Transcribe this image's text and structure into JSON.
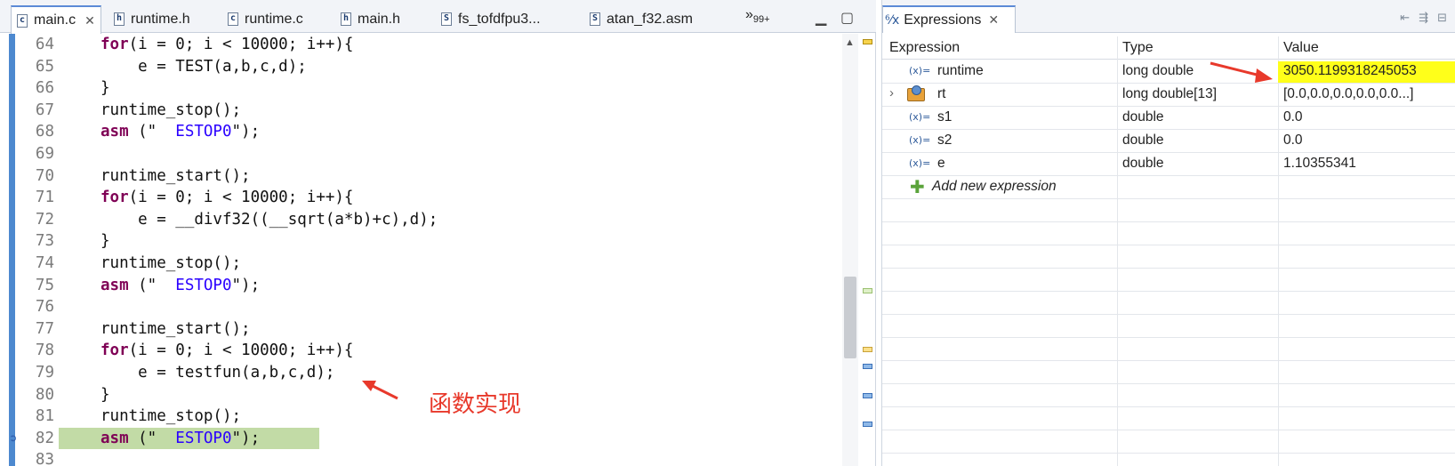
{
  "editor": {
    "tabs": [
      {
        "label": "main.c",
        "type_letter": "c",
        "active": true,
        "closable": true
      },
      {
        "label": "runtime.h",
        "type_letter": "h"
      },
      {
        "label": "runtime.c",
        "type_letter": "c"
      },
      {
        "label": "main.h",
        "type_letter": "h"
      },
      {
        "label": "fs_tofdfpu3...",
        "type_letter": "S"
      },
      {
        "label": "atan_f32.asm",
        "type_letter": "S"
      }
    ],
    "overflow_label": "»",
    "overflow_count": "99+",
    "minimize_icon": "minimize-icon",
    "maximize_icon": "maximize-icon",
    "current_line": 82,
    "lines": [
      {
        "num": "64",
        "text": "    for(i = 0; i < 10000; i++){"
      },
      {
        "num": "65",
        "text": "        e = TEST(a,b,c,d);"
      },
      {
        "num": "66",
        "text": "    }"
      },
      {
        "num": "67",
        "text": "    runtime_stop();"
      },
      {
        "num": "68",
        "text": "    asm (\"  ESTOP0\");"
      },
      {
        "num": "69",
        "text": ""
      },
      {
        "num": "70",
        "text": "    runtime_start();"
      },
      {
        "num": "71",
        "text": "    for(i = 0; i < 10000; i++){"
      },
      {
        "num": "72",
        "text": "        e = __divf32((__sqrt(a*b)+c),d);"
      },
      {
        "num": "73",
        "text": "    }"
      },
      {
        "num": "74",
        "text": "    runtime_stop();"
      },
      {
        "num": "75",
        "text": "    asm (\"  ESTOP0\");"
      },
      {
        "num": "76",
        "text": ""
      },
      {
        "num": "77",
        "text": "    runtime_start();"
      },
      {
        "num": "78",
        "text": "    for(i = 0; i < 10000; i++){"
      },
      {
        "num": "79",
        "text": "        e = testfun(a,b,c,d);"
      },
      {
        "num": "80",
        "text": "    }"
      },
      {
        "num": "81",
        "text": "    runtime_stop();"
      },
      {
        "num": "82",
        "text": "    asm (\"  ESTOP0\");"
      },
      {
        "num": "83",
        "text": ""
      }
    ],
    "annotation_text": "函数实现"
  },
  "expressions": {
    "tab_label": "Expressions",
    "toolbar_icons": [
      "collapse-all-icon",
      "new-expression-icon",
      "remove-icon"
    ],
    "columns": {
      "expression": "Expression",
      "type": "Type",
      "value": "Value"
    },
    "rows": [
      {
        "name": "runtime",
        "type": "long double",
        "value": "3050.1199318245053",
        "highlighted": true,
        "icon": "variable-icon"
      },
      {
        "name": "rt",
        "type": "long double[13]",
        "value": "[0.0,0.0,0.0,0.0,0.0...]",
        "expandable": true,
        "icon": "struct-icon"
      },
      {
        "name": "s1",
        "type": "double",
        "value": "0.0",
        "icon": "variable-icon"
      },
      {
        "name": "s2",
        "type": "double",
        "value": "0.0",
        "icon": "variable-icon"
      },
      {
        "name": "e",
        "type": "double",
        "value": "1.10355341",
        "icon": "variable-icon"
      }
    ],
    "add_new_label": "Add new expression"
  },
  "colors": {
    "highlight_yellow": "#ffff1a",
    "annotation_red": "#e8392b",
    "current_line_green": "#c2dba6",
    "keyword": "#7f0055",
    "string": "#2a00ff"
  }
}
